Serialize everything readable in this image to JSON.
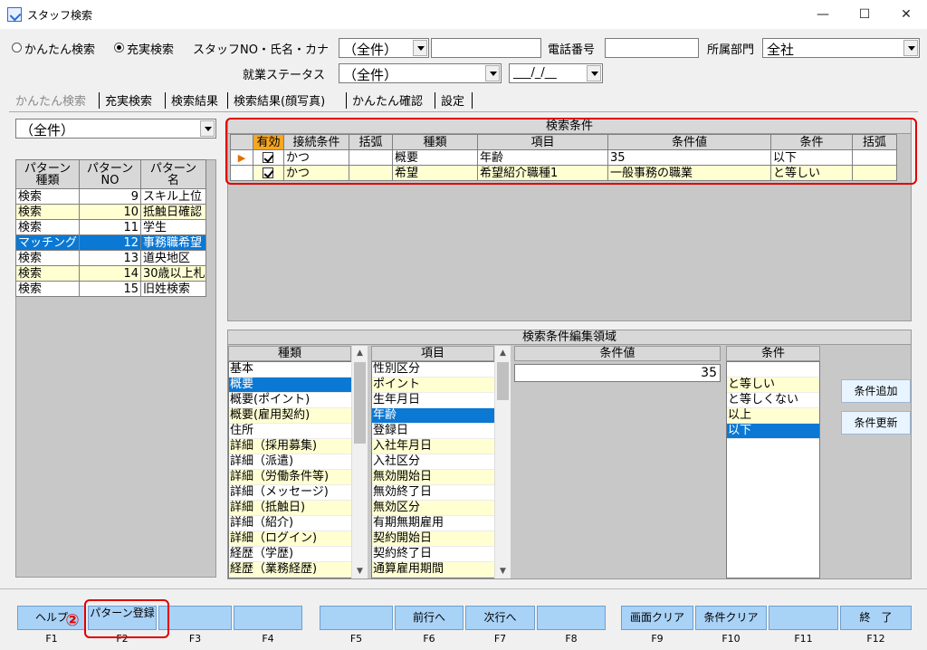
{
  "window": {
    "title": "スタッフ検索",
    "minimize": "—",
    "maximize": "☐",
    "close": "✕",
    "icon": "app-icon"
  },
  "search_mode": {
    "simple_label": "かんたん検索",
    "advanced_label": "充実検索",
    "selected": "advanced"
  },
  "criteria_bar": {
    "staff_label": "スタッフNO・氏名・カナ",
    "staff_select": "（全件）",
    "staff_input": "",
    "phone_label": "電話番号",
    "phone_input": "",
    "dept_label": "所属部門",
    "dept_select": "全社",
    "work_status_label": "就業ステータス",
    "work_status_select": "（全件）",
    "date_select": "___/_/__"
  },
  "tabs": [
    {
      "label": "かんたん検索",
      "active": false
    },
    {
      "label": "充実検索",
      "active": true
    },
    {
      "label": "検索結果",
      "active": false
    },
    {
      "label": "検索結果(顔写真)",
      "active": false
    },
    {
      "label": "かんたん確認",
      "active": false
    },
    {
      "label": "設定",
      "active": false
    }
  ],
  "pattern_panel": {
    "filter_select": "（全件）",
    "headers": [
      "パターン種類",
      "パターンNO",
      "パターン名"
    ],
    "header_lines": [
      [
        "パターン",
        "種類"
      ],
      [
        "パターン",
        "NO"
      ],
      [
        "パターン",
        "名"
      ]
    ],
    "rows": [
      {
        "type": "検索",
        "no": "9",
        "name": "スキル上位"
      },
      {
        "type": "検索",
        "no": "10",
        "name": "抵触日確認"
      },
      {
        "type": "検索",
        "no": "11",
        "name": "学生"
      },
      {
        "type": "マッチング",
        "no": "12",
        "name": "事務職希望"
      },
      {
        "type": "検索",
        "no": "13",
        "name": "道央地区"
      },
      {
        "type": "検索",
        "no": "14",
        "name": "30歳以上札"
      },
      {
        "type": "検索",
        "no": "15",
        "name": "旧姓検索"
      }
    ]
  },
  "conditions": {
    "title": "検索条件",
    "headers": [
      "有効",
      "接続条件",
      "括弧",
      "種類",
      "項目",
      "条件値",
      "条件",
      "括弧"
    ],
    "rows": [
      {
        "enabled": true,
        "connector": "かつ",
        "paren_open": "",
        "category": "概要",
        "item": "年齢",
        "value": "35",
        "op": "以下",
        "paren_close": "",
        "current": true
      },
      {
        "enabled": true,
        "connector": "かつ",
        "paren_open": "",
        "category": "希望",
        "item": "希望紹介職種1",
        "value": "一般事務の職業",
        "op": "と等しい",
        "paren_close": "",
        "current": false
      }
    ]
  },
  "editor": {
    "title": "検索条件編集領域",
    "category_header": "種類",
    "categories": [
      "基本",
      "概要",
      "概要(ポイント)",
      "概要(雇用契約)",
      "住所",
      "詳細（採用募集)",
      "詳細（派遣)",
      "詳細（労働条件等)",
      "詳細（メッセージ)",
      "詳細（抵触日)",
      "詳細（紹介)",
      "詳細（ログイン)",
      "経歴（学歴)",
      "経歴（業務経歴)"
    ],
    "category_selected": 1,
    "item_header": "項目",
    "items": [
      "性別区分",
      "ポイント",
      "生年月日",
      "年齢",
      "登録日",
      "入社年月日",
      "入社区分",
      "無効開始日",
      "無効終了日",
      "無効区分",
      "有期無期雇用",
      "契約開始日",
      "契約終了日",
      "通算雇用期間"
    ],
    "item_selected": 3,
    "value_header": "条件値",
    "value": "35",
    "op_header": "条件",
    "ops": [
      "",
      "と等しい",
      "と等しくない",
      "以上",
      "以下"
    ],
    "op_selected": 4,
    "add_button": "条件追加",
    "update_button": "条件更新"
  },
  "function_keys": [
    {
      "key": "F1",
      "label": "ヘルプ"
    },
    {
      "key": "F2",
      "label": "パターン登録"
    },
    {
      "key": "F3",
      "label": ""
    },
    {
      "key": "F4",
      "label": ""
    },
    {
      "key": "F5",
      "label": ""
    },
    {
      "key": "F6",
      "label": "前行へ"
    },
    {
      "key": "F7",
      "label": "次行へ"
    },
    {
      "key": "F8",
      "label": ""
    },
    {
      "key": "F9",
      "label": "画面クリア"
    },
    {
      "key": "F10",
      "label": "条件クリア"
    },
    {
      "key": "F11",
      "label": ""
    },
    {
      "key": "F12",
      "label": "終　了"
    }
  ],
  "callout": {
    "marker": "②",
    "color": "#e00000"
  }
}
